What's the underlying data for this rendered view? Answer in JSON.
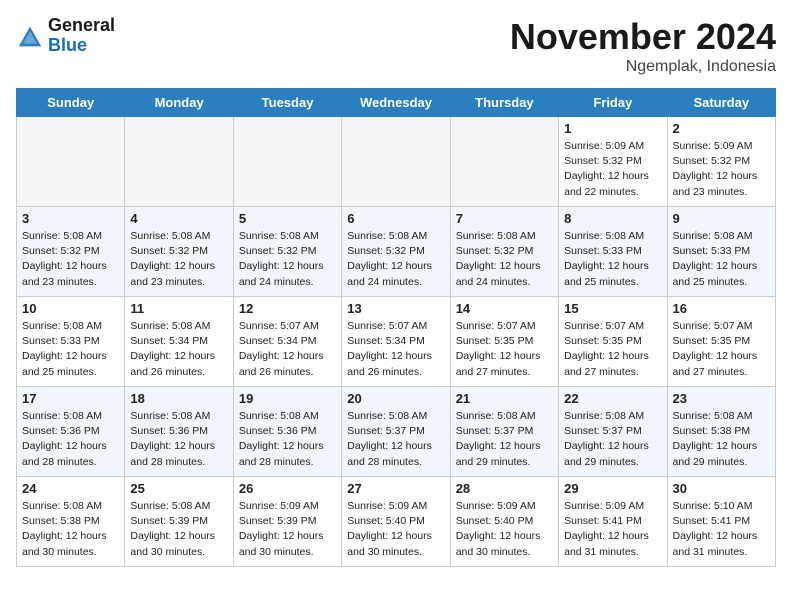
{
  "header": {
    "logo_general": "General",
    "logo_blue": "Blue",
    "month_title": "November 2024",
    "location": "Ngemplak, Indonesia"
  },
  "days_of_week": [
    "Sunday",
    "Monday",
    "Tuesday",
    "Wednesday",
    "Thursday",
    "Friday",
    "Saturday"
  ],
  "weeks": [
    [
      {
        "day": "",
        "info": ""
      },
      {
        "day": "",
        "info": ""
      },
      {
        "day": "",
        "info": ""
      },
      {
        "day": "",
        "info": ""
      },
      {
        "day": "",
        "info": ""
      },
      {
        "day": "1",
        "info": "Sunrise: 5:09 AM\nSunset: 5:32 PM\nDaylight: 12 hours\nand 22 minutes."
      },
      {
        "day": "2",
        "info": "Sunrise: 5:09 AM\nSunset: 5:32 PM\nDaylight: 12 hours\nand 23 minutes."
      }
    ],
    [
      {
        "day": "3",
        "info": "Sunrise: 5:08 AM\nSunset: 5:32 PM\nDaylight: 12 hours\nand 23 minutes."
      },
      {
        "day": "4",
        "info": "Sunrise: 5:08 AM\nSunset: 5:32 PM\nDaylight: 12 hours\nand 23 minutes."
      },
      {
        "day": "5",
        "info": "Sunrise: 5:08 AM\nSunset: 5:32 PM\nDaylight: 12 hours\nand 24 minutes."
      },
      {
        "day": "6",
        "info": "Sunrise: 5:08 AM\nSunset: 5:32 PM\nDaylight: 12 hours\nand 24 minutes."
      },
      {
        "day": "7",
        "info": "Sunrise: 5:08 AM\nSunset: 5:32 PM\nDaylight: 12 hours\nand 24 minutes."
      },
      {
        "day": "8",
        "info": "Sunrise: 5:08 AM\nSunset: 5:33 PM\nDaylight: 12 hours\nand 25 minutes."
      },
      {
        "day": "9",
        "info": "Sunrise: 5:08 AM\nSunset: 5:33 PM\nDaylight: 12 hours\nand 25 minutes."
      }
    ],
    [
      {
        "day": "10",
        "info": "Sunrise: 5:08 AM\nSunset: 5:33 PM\nDaylight: 12 hours\nand 25 minutes."
      },
      {
        "day": "11",
        "info": "Sunrise: 5:08 AM\nSunset: 5:34 PM\nDaylight: 12 hours\nand 26 minutes."
      },
      {
        "day": "12",
        "info": "Sunrise: 5:07 AM\nSunset: 5:34 PM\nDaylight: 12 hours\nand 26 minutes."
      },
      {
        "day": "13",
        "info": "Sunrise: 5:07 AM\nSunset: 5:34 PM\nDaylight: 12 hours\nand 26 minutes."
      },
      {
        "day": "14",
        "info": "Sunrise: 5:07 AM\nSunset: 5:35 PM\nDaylight: 12 hours\nand 27 minutes."
      },
      {
        "day": "15",
        "info": "Sunrise: 5:07 AM\nSunset: 5:35 PM\nDaylight: 12 hours\nand 27 minutes."
      },
      {
        "day": "16",
        "info": "Sunrise: 5:07 AM\nSunset: 5:35 PM\nDaylight: 12 hours\nand 27 minutes."
      }
    ],
    [
      {
        "day": "17",
        "info": "Sunrise: 5:08 AM\nSunset: 5:36 PM\nDaylight: 12 hours\nand 28 minutes."
      },
      {
        "day": "18",
        "info": "Sunrise: 5:08 AM\nSunset: 5:36 PM\nDaylight: 12 hours\nand 28 minutes."
      },
      {
        "day": "19",
        "info": "Sunrise: 5:08 AM\nSunset: 5:36 PM\nDaylight: 12 hours\nand 28 minutes."
      },
      {
        "day": "20",
        "info": "Sunrise: 5:08 AM\nSunset: 5:37 PM\nDaylight: 12 hours\nand 28 minutes."
      },
      {
        "day": "21",
        "info": "Sunrise: 5:08 AM\nSunset: 5:37 PM\nDaylight: 12 hours\nand 29 minutes."
      },
      {
        "day": "22",
        "info": "Sunrise: 5:08 AM\nSunset: 5:37 PM\nDaylight: 12 hours\nand 29 minutes."
      },
      {
        "day": "23",
        "info": "Sunrise: 5:08 AM\nSunset: 5:38 PM\nDaylight: 12 hours\nand 29 minutes."
      }
    ],
    [
      {
        "day": "24",
        "info": "Sunrise: 5:08 AM\nSunset: 5:38 PM\nDaylight: 12 hours\nand 30 minutes."
      },
      {
        "day": "25",
        "info": "Sunrise: 5:08 AM\nSunset: 5:39 PM\nDaylight: 12 hours\nand 30 minutes."
      },
      {
        "day": "26",
        "info": "Sunrise: 5:09 AM\nSunset: 5:39 PM\nDaylight: 12 hours\nand 30 minutes."
      },
      {
        "day": "27",
        "info": "Sunrise: 5:09 AM\nSunset: 5:40 PM\nDaylight: 12 hours\nand 30 minutes."
      },
      {
        "day": "28",
        "info": "Sunrise: 5:09 AM\nSunset: 5:40 PM\nDaylight: 12 hours\nand 30 minutes."
      },
      {
        "day": "29",
        "info": "Sunrise: 5:09 AM\nSunset: 5:41 PM\nDaylight: 12 hours\nand 31 minutes."
      },
      {
        "day": "30",
        "info": "Sunrise: 5:10 AM\nSunset: 5:41 PM\nDaylight: 12 hours\nand 31 minutes."
      }
    ]
  ]
}
